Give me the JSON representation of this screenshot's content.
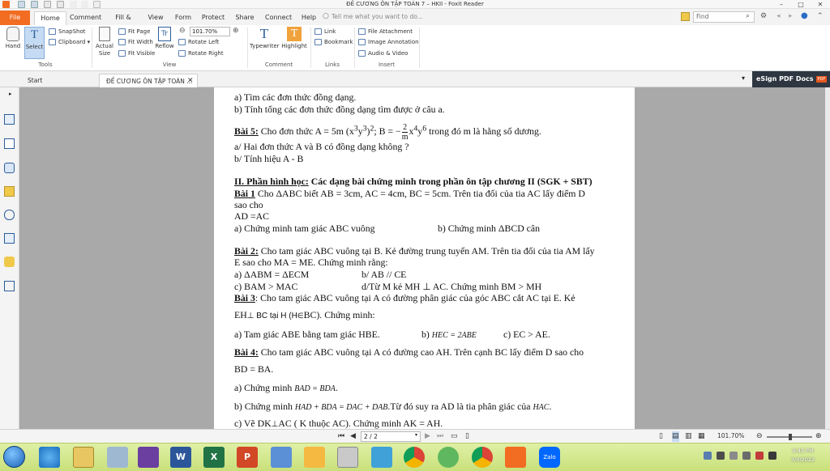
{
  "window": {
    "title": "ĐỀ CƯƠNG ÔN TẬP TOÁN 7 – HKII - Foxit Reader",
    "controls": [
      "–",
      "□",
      "✕"
    ]
  },
  "menu": {
    "tabs": [
      "File",
      "Home",
      "Comment",
      "Fill & Sign",
      "View",
      "Form",
      "Protect",
      "Share",
      "Connect",
      "Help"
    ],
    "tell_me": "Tell me what you want to do...",
    "find_placeholder": "Find"
  },
  "ribbon": {
    "hand": "Hand",
    "select": "Select",
    "snapshot": "SnapShot",
    "clipboard": "Clipboard",
    "actual_size": [
      "Actual",
      "Size"
    ],
    "fit_page": "Fit Page",
    "fit_width": "Fit Width",
    "fit_visible": "Fit Visible",
    "reflow": "Reflow",
    "zoom_value": "101.70%",
    "rotate_left": "Rotate Left",
    "rotate_right": "Rotate Right",
    "typewriter": "Typewriter",
    "highlight": "Highlight",
    "link": "Link",
    "bookmark": "Bookmark",
    "file_attachment": "File Attachment",
    "image_annotation": "Image Annotation",
    "audio_video": "Audio & Video",
    "groups": {
      "tools": "Tools",
      "view": "View",
      "comment": "Comment",
      "links": "Links",
      "insert": "Insert"
    }
  },
  "doc_tabs": {
    "start": "Start",
    "active": "ĐỀ CƯƠNG ÔN TẬP TOÁN ...",
    "esign": "eSign PDF Docs",
    "esign_badge": "PDF"
  },
  "document": {
    "lines": {
      "l1": "a) Tìm các đơn thức đồng dạng.",
      "l2": "b) Tính tổng các đơn thức đồng dạng tìm được ở câu a.",
      "l3_label": "Bài 5:",
      "l3_a": " Cho đơn thức A = 5m (x",
      "l3_b": "y",
      "l3_c": ")",
      "l3_d": "; B = −",
      "l3_num": "2",
      "l3_den": "m",
      "l3_e": "x",
      "l3_f": "y",
      "l3_g": " trong đó m là hằng số dương.",
      "l4": "a/ Hai đơn thức A và B có đồng dạng không ?",
      "l5": "b/ Tính hiệu A - B",
      "l6_label": "II. Phần hình học:",
      "l6_rest": " Các dạng bài chứng minh trong phần ôn tập chương II (SGK + SBT)",
      "l7_label": "Bài 1",
      "l7_rest": "  Cho ΔABC biết AB = 3cm, AC = 4cm, BC = 5cm. Trên tia đối của tia AC lấy điểm D",
      "l8": "sao cho",
      "l9": " AD =AC",
      "l10a": "a) Chứng minh tam giác ABC vuông",
      "l10b": "b) Chứng minh  ΔBCD cân",
      "l11_label": "Bài 2:",
      "l11_rest": " Cho tam giác ABC vuông tại B. Kẻ đường trung tuyến AM. Trên tia đối của tia AM lấy",
      "l12": "E sao cho MA = ME. Chứng minh rằng:",
      "l13a": "a) ΔABM = ΔECM",
      "l13b": "b/ AB // CE",
      "l14a": "c) BAM  >  MAC",
      "l14b": "d/Từ M kẻ MH ⊥ AC. Chứng minh BM > MH",
      "l15_label": "Bài 3",
      "l15_rest": ": Cho tam giác ABC vuông tại A có  đường phân giác của góc ABC cắt AC tại E. Kẻ",
      "l16a": "EH",
      "l16b": "⊥ BC tại H (H",
      "l16c": "∈",
      "l16d": "BC). Chứng  minh:",
      "l17a": "a) Tam giác ABE bằng tam giác HBE.",
      "l17b": "b)",
      "l17c": "HEC = 2ABE",
      "l17d": "c) EC > AE.",
      "l18_label": "Bài 4:",
      "l18_rest": " Cho tam giác ABC vuông tại A có đường cao  AH.  Trên cạnh BC lấy điểm D sao cho",
      "l19": "BD = BA.",
      "l20a": "a) Chứng minh",
      "l20b": "BAD = BDA",
      "l20c": ".",
      "l21a": "b) Chứng minh",
      "l21b": "HAD + BDA = DAC + DAB",
      "l21c": ".Từ đó suy ra AD là tia phân giác của",
      "l21d": "HAC",
      "l21e": ".",
      "l22a": "c) Vẽ DK",
      "l22b": "⊥",
      "l22c": "AC ( K thuộc AC). Chứng minh AK = AH."
    },
    "sup": {
      "x3": "3",
      "y3": "3",
      "p2": "2",
      "x4": "4",
      "y6": "6"
    }
  },
  "status": {
    "page": "2 / 2",
    "zoom": "101.70%"
  },
  "taskbar": {
    "clock_time": "9:43 PM",
    "clock_date": "3/4/2022",
    "icons": [
      "start-orb",
      "ie",
      "explorer",
      "visual-studio",
      "word",
      "excel",
      "powerpoint",
      "tool",
      "foxit",
      "paint",
      "calculator",
      "chrome",
      "app",
      "chrome-2",
      "foxit-2",
      "zalo"
    ],
    "colors": {
      "word": "#2b579a",
      "excel": "#217346",
      "powerpoint": "#d24726",
      "chrome": "#4285f4",
      "foxit": "#f26c21",
      "zalo": "#0068ff"
    }
  }
}
